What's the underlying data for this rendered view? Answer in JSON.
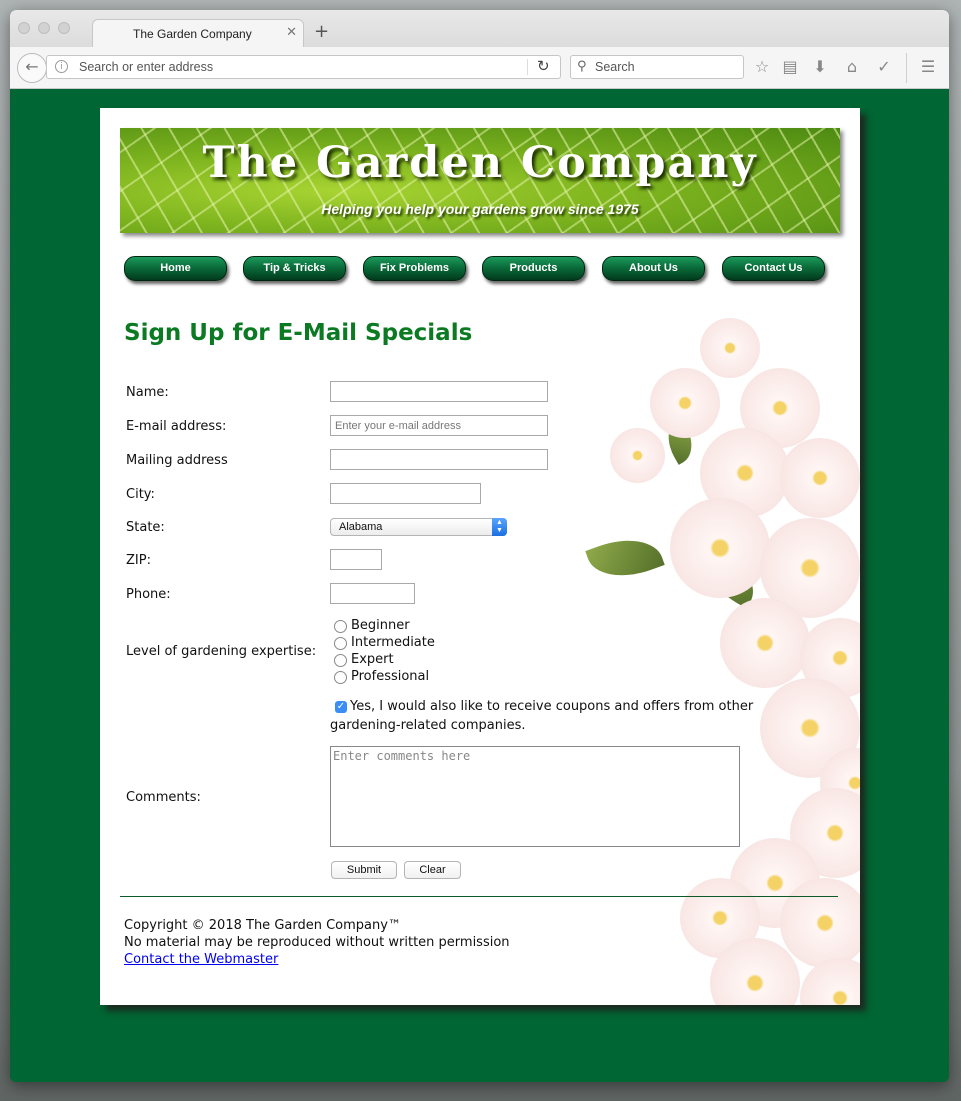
{
  "browser": {
    "tab_title": "The Garden Company",
    "tab_close": "✕",
    "new_tab": "+",
    "address_placeholder": "Search or enter address",
    "search_placeholder": "Search"
  },
  "banner": {
    "title": "The Garden Company",
    "tagline": "Helping you help your gardens grow since 1975"
  },
  "nav": [
    "Home",
    "Tip & Tricks",
    "Fix Problems",
    "Products",
    "About Us",
    "Contact Us"
  ],
  "form": {
    "heading": "Sign Up for E-Mail Specials",
    "labels": {
      "name": "Name:",
      "email": "E-mail address:",
      "mailing": "Mailing address",
      "city": "City:",
      "state": "State:",
      "zip": "ZIP:",
      "phone": "Phone:",
      "expertise": "Level of gardening expertise:",
      "comments": "Comments:"
    },
    "email_placeholder": "Enter your e-mail address",
    "state_selected": "Alabama",
    "expertise_options": [
      "Beginner",
      "Intermediate",
      "Expert",
      "Professional"
    ],
    "coupons_label": "Yes, I would also like to receive coupons and offers from other gardening-related companies.",
    "coupons_checked": true,
    "comments_placeholder": "Enter comments here",
    "submit_label": "Submit",
    "clear_label": "Clear"
  },
  "footer": {
    "copyright": "Copyright © 2018 The Garden Company™",
    "notice": "No material may be reproduced without written permission",
    "link": "Contact the Webmaster"
  },
  "colors": {
    "page_background": "#006633",
    "heading_green": "#0b7a23",
    "nav_button": "#0a6c3a",
    "link": "#0000ee"
  }
}
